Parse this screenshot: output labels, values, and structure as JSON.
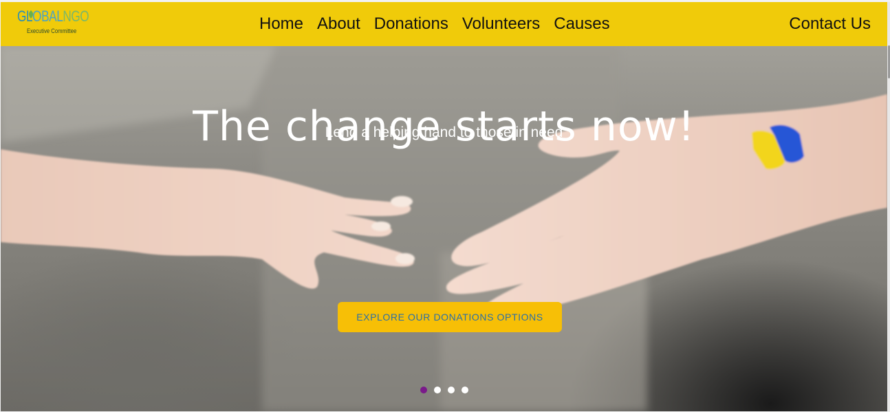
{
  "header": {
    "logo": {
      "main_g": "GL",
      "main_obal": "OBAL",
      "main_ngo": "NGO",
      "sub": "Executive Committee"
    },
    "nav": [
      {
        "label": "Home"
      },
      {
        "label": "About"
      },
      {
        "label": "Donations"
      },
      {
        "label": "Volunteers"
      },
      {
        "label": "Causes"
      }
    ],
    "contact": "Contact Us"
  },
  "hero": {
    "title": "The change starts now!",
    "subtitle": "Lend a helping hand to those in need",
    "cta": "EXPLORE OUR DONATIONS OPTIONS",
    "slides": {
      "count": 4,
      "active": 1
    }
  },
  "colors": {
    "header_bg": "#f0cb0a",
    "cta_bg": "#f7bf06",
    "cta_text": "#2a6fa8",
    "dot_active": "#7a1a8a",
    "dot_inactive": "#ffffff"
  }
}
